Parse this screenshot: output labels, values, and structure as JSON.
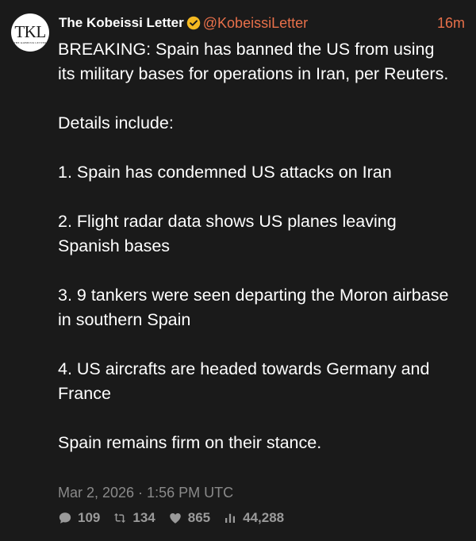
{
  "author": {
    "avatar_mark": "TKL",
    "avatar_sub": "THE KOBEISSI LETTER",
    "display_name": "The Kobeissi Letter",
    "handle": "@KobeissiLetter",
    "verified_icon": "verified-badge-icon",
    "verified_color": "#f5b921"
  },
  "post": {
    "time_ago": "16m",
    "paragraphs": [
      "BREAKING: Spain has banned the US from using its military bases for operations in Iran, per Reuters.",
      "Details include:",
      "1. Spain has condemned US attacks on Iran",
      "2. Flight radar data shows US planes leaving Spanish bases",
      "3. 9 tankers were seen departing the Moron airbase in southern Spain",
      "4. US aircrafts are headed towards Germany and France",
      "Spain remains firm on their stance."
    ],
    "timestamp": "Mar 2, 2026 · 1:56 PM UTC"
  },
  "metrics": {
    "replies": "109",
    "reposts": "134",
    "likes": "865",
    "views": "44,288"
  },
  "colors": {
    "background": "#1a1a1a",
    "accent": "#e8704a",
    "muted": "#8a8a8a"
  }
}
